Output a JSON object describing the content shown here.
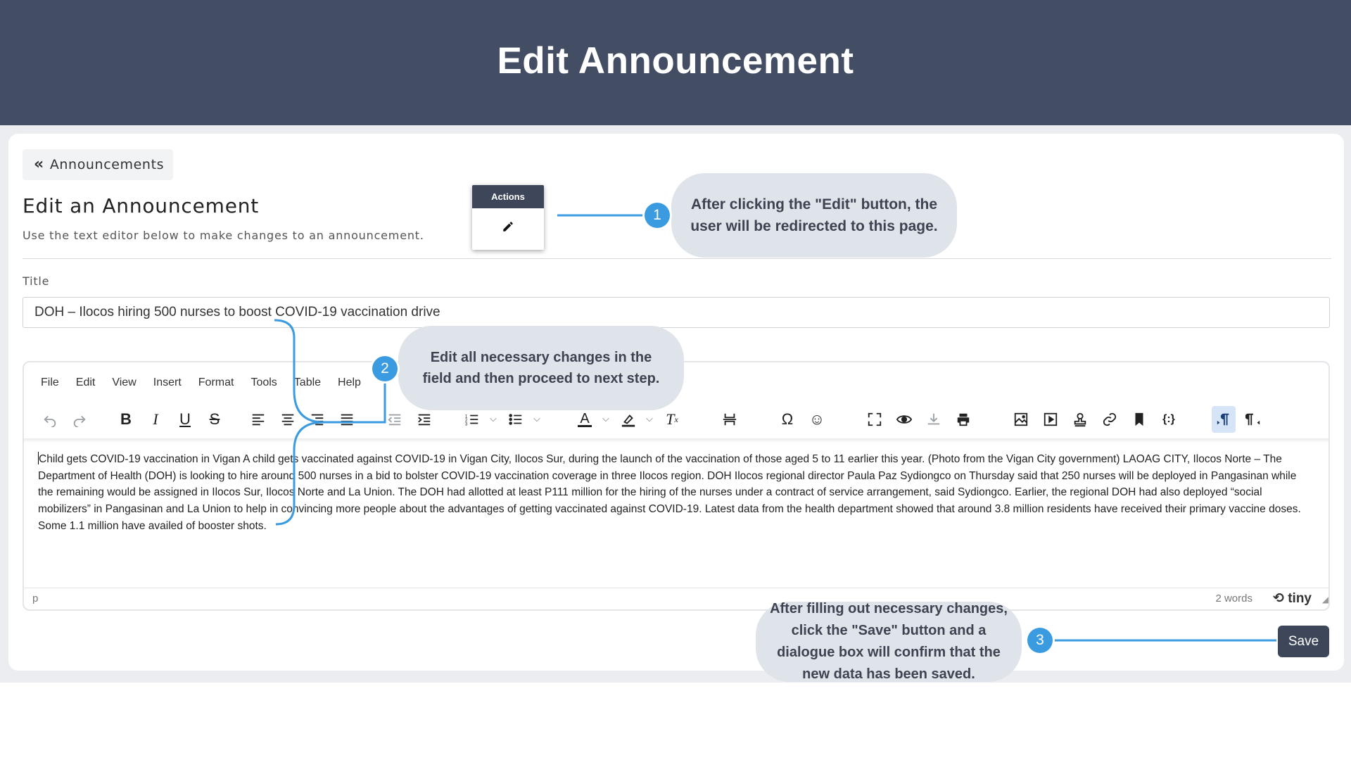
{
  "banner": {
    "title": "Edit Announcement"
  },
  "nav": {
    "back_label": "Announcements"
  },
  "page": {
    "title": "Edit an Announcement",
    "subtitle": "Use the text editor below to make changes to an announcement."
  },
  "form": {
    "title_label": "Title",
    "title_value": "DOH – Ilocos hiring 500 nurses to boost COVID-19 vaccination drive"
  },
  "editor": {
    "menu": [
      "File",
      "Edit",
      "View",
      "Insert",
      "Format",
      "Tools",
      "Table",
      "Help"
    ],
    "toolbar_icons": [
      "undo-icon",
      "redo-icon",
      "bold-icon",
      "italic-icon",
      "underline-icon",
      "strikethrough-icon",
      "align-left-icon",
      "align-center-icon",
      "align-right-icon",
      "align-justify-icon",
      "outdent-icon",
      "indent-icon",
      "numbered-list-icon",
      "bullet-list-icon",
      "text-color-icon",
      "highlight-icon",
      "clear-format-icon",
      "page-break-icon",
      "special-char-icon",
      "emoji-icon",
      "fullscreen-icon",
      "preview-icon",
      "save-icon",
      "print-icon",
      "image-icon",
      "media-icon",
      "template-icon",
      "link-icon",
      "anchor-icon",
      "code-sample-icon",
      "ltr-icon",
      "rtl-icon"
    ],
    "content": "Child gets COVID-19 vaccination in Vigan A child gets vaccinated against COVID-19 in Vigan City, Ilocos Sur, during the launch of the vaccination of those aged 5 to 11 earlier this year. (Photo from the Vigan City government) LAOAG CITY, Ilocos Norte – The Department of Health (DOH) is looking to hire around 500 nurses in a bid to bolster COVID-19 vaccination coverage in three Ilocos region. DOH Ilocos regional director Paula Paz Sydiongco on Thursday said that 250 nurses will be deployed in Pangasinan while the remaining would be assigned in Ilocos Sur, Ilocos Norte and La Union. The DOH had allotted at least P111 million for the hiring of the nurses under a contract of service arrangement, said Sydiongco. Earlier, the regional DOH had also deployed “social mobilizers” in Pangasinan and La Union to help in convincing more people about the advantages of getting vaccinated against COVID-19. Latest data from the health department showed that around 3.8 million residents have received their primary vaccine doses. Some 1.1 million have availed of booster shots.",
    "status_path": "p",
    "word_count": "2 words",
    "brand": "tiny"
  },
  "save_label": "Save",
  "actions_popup": {
    "header": "Actions"
  },
  "annotations": [
    {
      "number": "1",
      "text": "After clicking the \"Edit\" button, the user will be redirected to this page."
    },
    {
      "number": "2",
      "text": "Edit all necessary changes in the field and then proceed to next step."
    },
    {
      "number": "3",
      "text": "After filling out necessary changes, click the \"Save\" button and a dialogue box will confirm that the new data has been saved."
    }
  ],
  "colors": {
    "banner": "#434d63",
    "step_circle": "#3a9be0",
    "bubble": "#dfe3ea",
    "save_button": "#3e475a"
  }
}
